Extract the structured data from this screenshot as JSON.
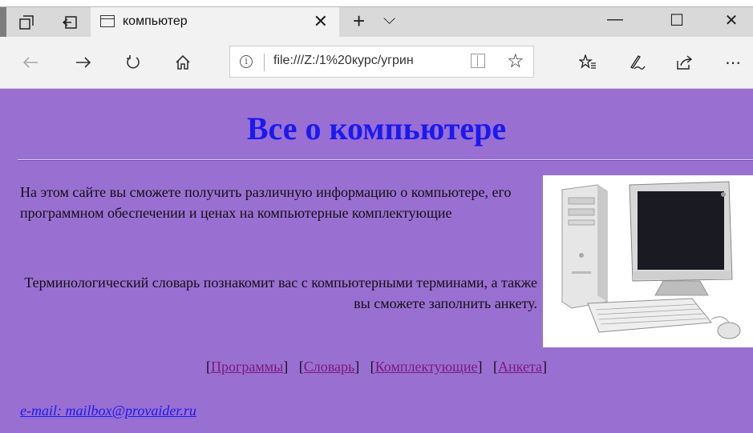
{
  "tab": {
    "title": "компьютер"
  },
  "address_bar": {
    "url": "file:///Z:/1%20курс/угрин"
  },
  "colors": {
    "page_background": "#9a6fd2",
    "heading": "#1a1af0",
    "link": "#7a1a7a",
    "email": "#1a1af0"
  },
  "page": {
    "title": "Все о компьютере",
    "intro": "На этом сайте вы сможете получить различную информацию о компьютере, его программном обеспечении и ценах на компьютерные комплектующие",
    "dictionary_note": "Терминологический словарь познакомит вас с компьютерными терминами, а также вы сможете заполнить анкету.",
    "links": [
      {
        "label": "Программы"
      },
      {
        "label": "Словарь"
      },
      {
        "label": "Комплектующие"
      },
      {
        "label": "Анкета"
      }
    ],
    "email": "e-mail: mailbox@provaider.ru"
  },
  "icons": {
    "tab_bar": [
      "tab-preview-icon",
      "set-aside-tabs-icon",
      "page-icon",
      "close-icon",
      "new-tab-icon",
      "tab-list-icon"
    ],
    "window": [
      "minimize-icon",
      "maximize-icon",
      "close-icon"
    ],
    "navigation": [
      "back-icon",
      "forward-icon",
      "refresh-icon",
      "home-icon"
    ],
    "address": [
      "info-icon",
      "reading-view-icon",
      "favorite-star-icon"
    ],
    "toolbar": [
      "favorites-icon",
      "web-note-icon",
      "share-icon",
      "more-icon"
    ]
  }
}
